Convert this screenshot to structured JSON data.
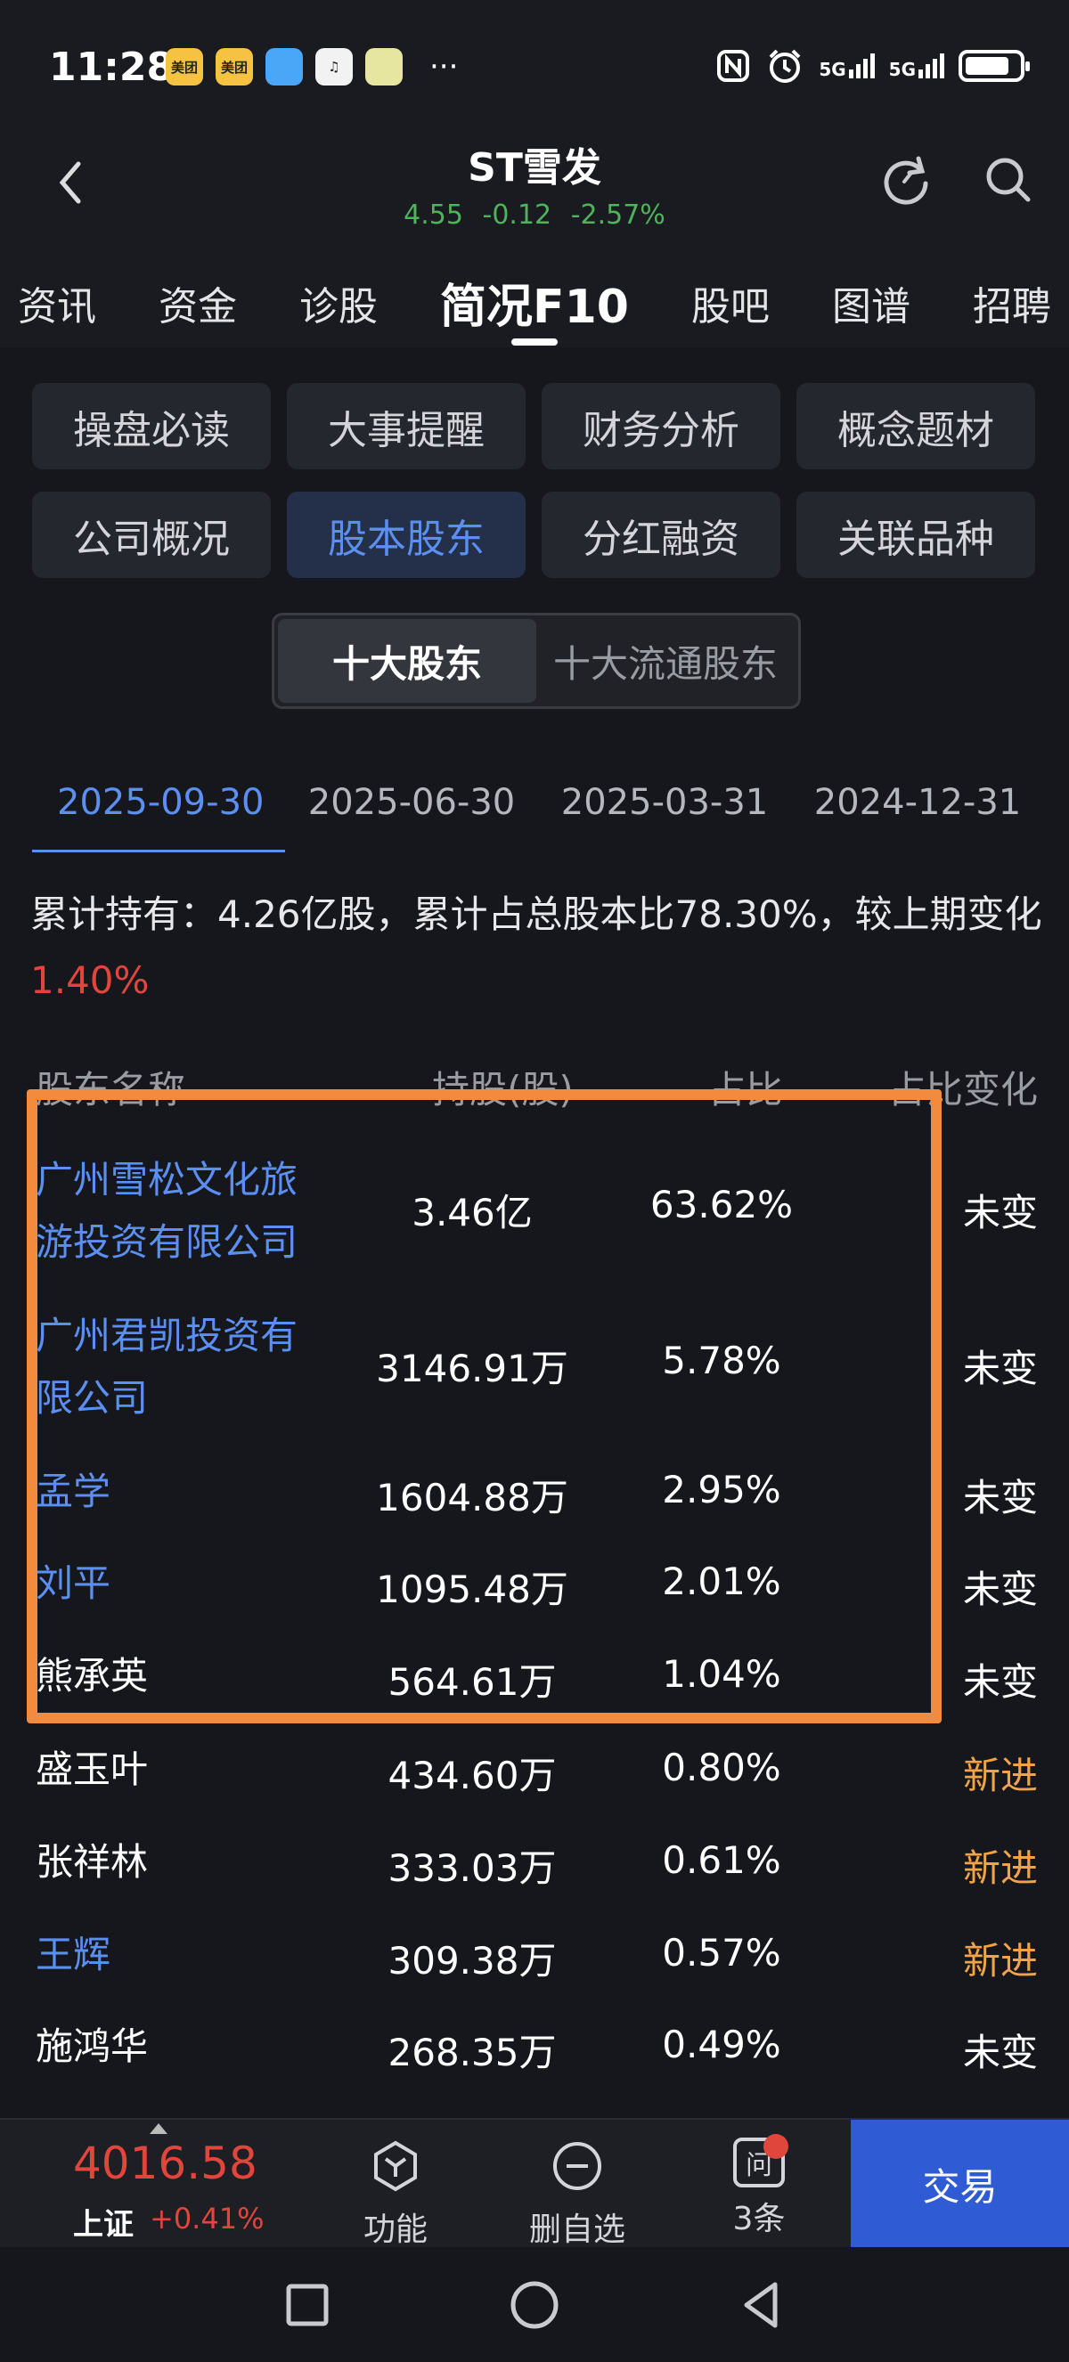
{
  "status_bar": {
    "time": "11:28",
    "apps": [
      {
        "name": "meituan-icon",
        "text": "美团",
        "color": "#f5c242"
      },
      {
        "name": "meituan-icon",
        "text": "美团",
        "color": "#f5c242"
      },
      {
        "name": "browser-icon",
        "text": "",
        "color": "#4aa7f7"
      },
      {
        "name": "music-icon",
        "text": "♫",
        "color": "#f2f2f2"
      },
      {
        "name": "vivo-icon",
        "text": "",
        "color": "#e6e6a0"
      }
    ],
    "more": "···",
    "right_icons": [
      "nfc-icon",
      "alarm-icon",
      "signal-5g-icon",
      "signal-5g-icon",
      "battery-icon"
    ],
    "signal_label": "5G"
  },
  "header": {
    "title": "ST雪发",
    "quote": {
      "price": "4.55",
      "change": "-0.12",
      "change_pct": "-2.57%"
    }
  },
  "nav_tabs": [
    {
      "label": "资讯",
      "active": false
    },
    {
      "label": "资金",
      "active": false
    },
    {
      "label": "诊股",
      "active": false
    },
    {
      "label": "简况F10",
      "active": true
    },
    {
      "label": "股吧",
      "active": false
    },
    {
      "label": "图谱",
      "active": false
    },
    {
      "label": "招聘",
      "active": false
    }
  ],
  "sub_menu": [
    {
      "label": "操盘必读",
      "active": false
    },
    {
      "label": "大事提醒",
      "active": false
    },
    {
      "label": "财务分析",
      "active": false
    },
    {
      "label": "概念题材",
      "active": false
    },
    {
      "label": "公司概况",
      "active": false
    },
    {
      "label": "股本股东",
      "active": true
    },
    {
      "label": "分红融资",
      "active": false
    },
    {
      "label": "关联品种",
      "active": false
    }
  ],
  "segment": [
    {
      "label": "十大股东",
      "active": true
    },
    {
      "label": "十大流通股东",
      "active": false
    }
  ],
  "date_tabs": [
    {
      "label": "2025-09-30",
      "active": true
    },
    {
      "label": "2025-06-30",
      "active": false
    },
    {
      "label": "2025-03-31",
      "active": false
    },
    {
      "label": "2024-12-31",
      "active": false
    }
  ],
  "summary": {
    "text": "累计持有：4.26亿股，累计占总股本比78.30%，较上期变化",
    "change": "1.40%"
  },
  "table": {
    "headers": {
      "name": "股东名称",
      "shares": "持股(股)",
      "pct": "占比",
      "change": "占比变化"
    },
    "rows": [
      {
        "name_lines": [
          "广州雪松文化旅",
          "游投资有限公司"
        ],
        "shares": "3.46亿",
        "pct": "63.62%",
        "change": "未变",
        "link": true,
        "new": false
      },
      {
        "name_lines": [
          "广州君凯投资有",
          "限公司"
        ],
        "shares": "3146.91万",
        "pct": "5.78%",
        "change": "未变",
        "link": true,
        "new": false
      },
      {
        "name_lines": [
          "孟学"
        ],
        "shares": "1604.88万",
        "pct": "2.95%",
        "change": "未变",
        "link": true,
        "new": false
      },
      {
        "name_lines": [
          "刘平"
        ],
        "shares": "1095.48万",
        "pct": "2.01%",
        "change": "未变",
        "link": true,
        "new": false
      },
      {
        "name_lines": [
          "熊承英"
        ],
        "shares": "564.61万",
        "pct": "1.04%",
        "change": "未变",
        "link": false,
        "new": false
      },
      {
        "name_lines": [
          "盛玉叶"
        ],
        "shares": "434.60万",
        "pct": "0.80%",
        "change": "新进",
        "link": false,
        "new": true
      },
      {
        "name_lines": [
          "张祥林"
        ],
        "shares": "333.03万",
        "pct": "0.61%",
        "change": "新进",
        "link": false,
        "new": true
      },
      {
        "name_lines": [
          "王辉"
        ],
        "shares": "309.38万",
        "pct": "0.57%",
        "change": "新进",
        "link": true,
        "new": true
      },
      {
        "name_lines": [
          "施鸿华"
        ],
        "shares": "268.35万",
        "pct": "0.49%",
        "change": "未变",
        "link": false,
        "new": false
      }
    ]
  },
  "bottom_bar": {
    "index": {
      "value": "4016.58",
      "name": "上证",
      "change": "+0.41%"
    },
    "items": [
      {
        "label": "功能",
        "icon": "hexagon-function-icon"
      },
      {
        "label": "删自选",
        "icon": "minus-circle-icon"
      },
      {
        "label": "3条",
        "icon": "question-message-icon",
        "icon_text": "问"
      }
    ],
    "trade": "交易"
  },
  "colors": {
    "background": "#16171c",
    "accent_blue": "#5b8ff2",
    "up_red": "#e0463c",
    "down_green": "#4fb35a",
    "new_orange": "#f0a447",
    "highlight_box": "#f28b3e"
  }
}
